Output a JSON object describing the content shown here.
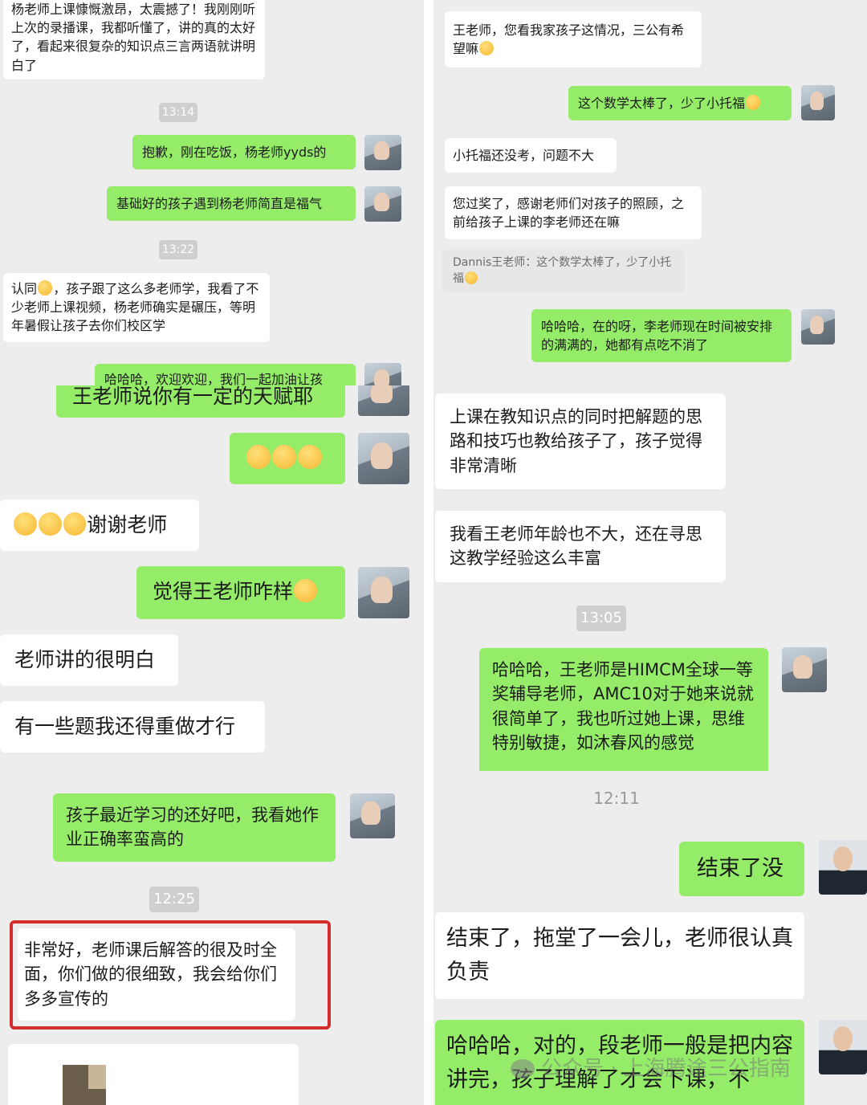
{
  "panels": {
    "p1": {
      "messages": [
        {
          "text": "杨老师上课慷慨激昂，太震撼了！我刚刚听上次的录播课，我都听懂了，讲的真的太好了，看起来很复杂的知识点三言两语就讲明白了"
        },
        {
          "text": "抱歉，刚在吃饭，杨老师yyds的"
        },
        {
          "text": "基础好的孩子遇到杨老师简直是福气"
        },
        {
          "pre": "认同",
          "text": "，孩子跟了这么多老师学，我看了不少老师上课视频，杨老师确实是碾压，等明年暑假让孩子去你们校区学"
        },
        {
          "text": "哈哈哈，欢迎欢迎，我们一起加油让孩"
        }
      ],
      "times": [
        "13:14",
        "13:22"
      ]
    },
    "p2": {
      "messages": [
        {
          "text": "王老师，您看我家孩子这情况，三公有希望嘛"
        },
        {
          "text": "这个数学太棒了，少了小托福"
        },
        {
          "text": "小托福还没考，问题不大"
        },
        {
          "text": "您过奖了，感谢老师们对孩子的照顾，之前给孩子上课的李老师还在嘛"
        },
        {
          "text": "Dannis王老师：这个数学太棒了，少了小托福"
        },
        {
          "text": "哈哈哈，在的呀，李老师现在时间被安排的满满的，她都有点吃不消了"
        }
      ]
    },
    "p3": {
      "messages": [
        {
          "text": "王老师说你有一定的天赋耶"
        },
        {
          "text": "谢谢老师"
        },
        {
          "text": "觉得王老师咋样"
        },
        {
          "text": "老师讲的很明白"
        },
        {
          "text": "有一些题我还得重做才行"
        }
      ]
    },
    "p4": {
      "messages": [
        {
          "text": "上课在教知识点的同时把解题的思路和技巧也教给孩子了，孩子觉得非常清晰"
        },
        {
          "text": "我看王老师年龄也不大，还在寻思这教学经验这么丰富"
        },
        {
          "text": "哈哈哈，王老师是HIMCM全球一等奖辅导老师，AMC10对于她来说就很简单了，我也听过她上课，思维特别敏捷，如沐春风的感觉"
        }
      ],
      "times": [
        "13:05"
      ]
    },
    "p5": {
      "messages": [
        {
          "text": "孩子最近学习的还好吧，我看她作业正确率蛮高的"
        },
        {
          "text": "非常好，老师课后解答的很及时全面，你们做的很细致，我会给你们多多宣传的"
        }
      ],
      "times": [
        "12:25"
      ]
    },
    "p6": {
      "messages": [
        {
          "text": "结束了没"
        },
        {
          "text": "结束了，拖堂了一会儿，老师很认真负责"
        },
        {
          "text": "哈哈哈，对的，段老师一般是把内容讲完，孩子理解了才会下课，不"
        }
      ],
      "times": [
        "12:11"
      ]
    }
  },
  "watermark": {
    "text": "公众号 · 上海腾途三公指南"
  },
  "colors": {
    "green_bubble": "#95ec69",
    "white_bubble": "#ffffff",
    "background": "#ededed",
    "highlight": "#d42b2b"
  }
}
